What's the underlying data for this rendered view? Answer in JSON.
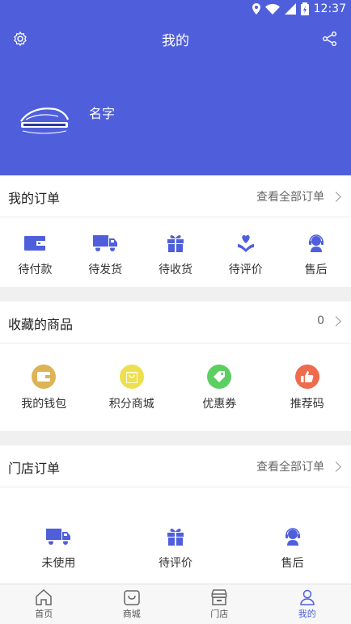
{
  "status": {
    "time": "12:37"
  },
  "header": {
    "title": "我的",
    "username": "名字"
  },
  "orders": {
    "title": "我的订单",
    "more": "查看全部订单",
    "items": [
      {
        "label": "待付款",
        "icon": "wallet-icon"
      },
      {
        "label": "待发货",
        "icon": "truck-icon"
      },
      {
        "label": "待收货",
        "icon": "gift-icon"
      },
      {
        "label": "待评价",
        "icon": "heart-hands-icon"
      },
      {
        "label": "售后",
        "icon": "support-agent-icon"
      }
    ]
  },
  "favorites": {
    "title": "收藏的商品",
    "count": "0",
    "items": [
      {
        "label": "我的钱包",
        "icon": "wallet-icon",
        "color": "#dcb355"
      },
      {
        "label": "积分商城",
        "icon": "shopping-bag-icon",
        "color": "#ede04f"
      },
      {
        "label": "优惠券",
        "icon": "tag-icon",
        "color": "#5bcf61"
      },
      {
        "label": "推荐码",
        "icon": "thumbs-up-icon",
        "color": "#ee6b4d"
      }
    ]
  },
  "store_orders": {
    "title": "门店订单",
    "more": "查看全部订单",
    "items": [
      {
        "label": "未使用",
        "icon": "truck-icon"
      },
      {
        "label": "待评价",
        "icon": "gift-icon"
      },
      {
        "label": "售后",
        "icon": "support-agent-icon"
      }
    ]
  },
  "nav": [
    {
      "label": "首页",
      "icon": "home-icon"
    },
    {
      "label": "商城",
      "icon": "bag-icon"
    },
    {
      "label": "门店",
      "icon": "store-icon"
    },
    {
      "label": "我的",
      "icon": "user-icon",
      "active": true
    }
  ],
  "colors": {
    "brand": "#4f5fdc"
  }
}
